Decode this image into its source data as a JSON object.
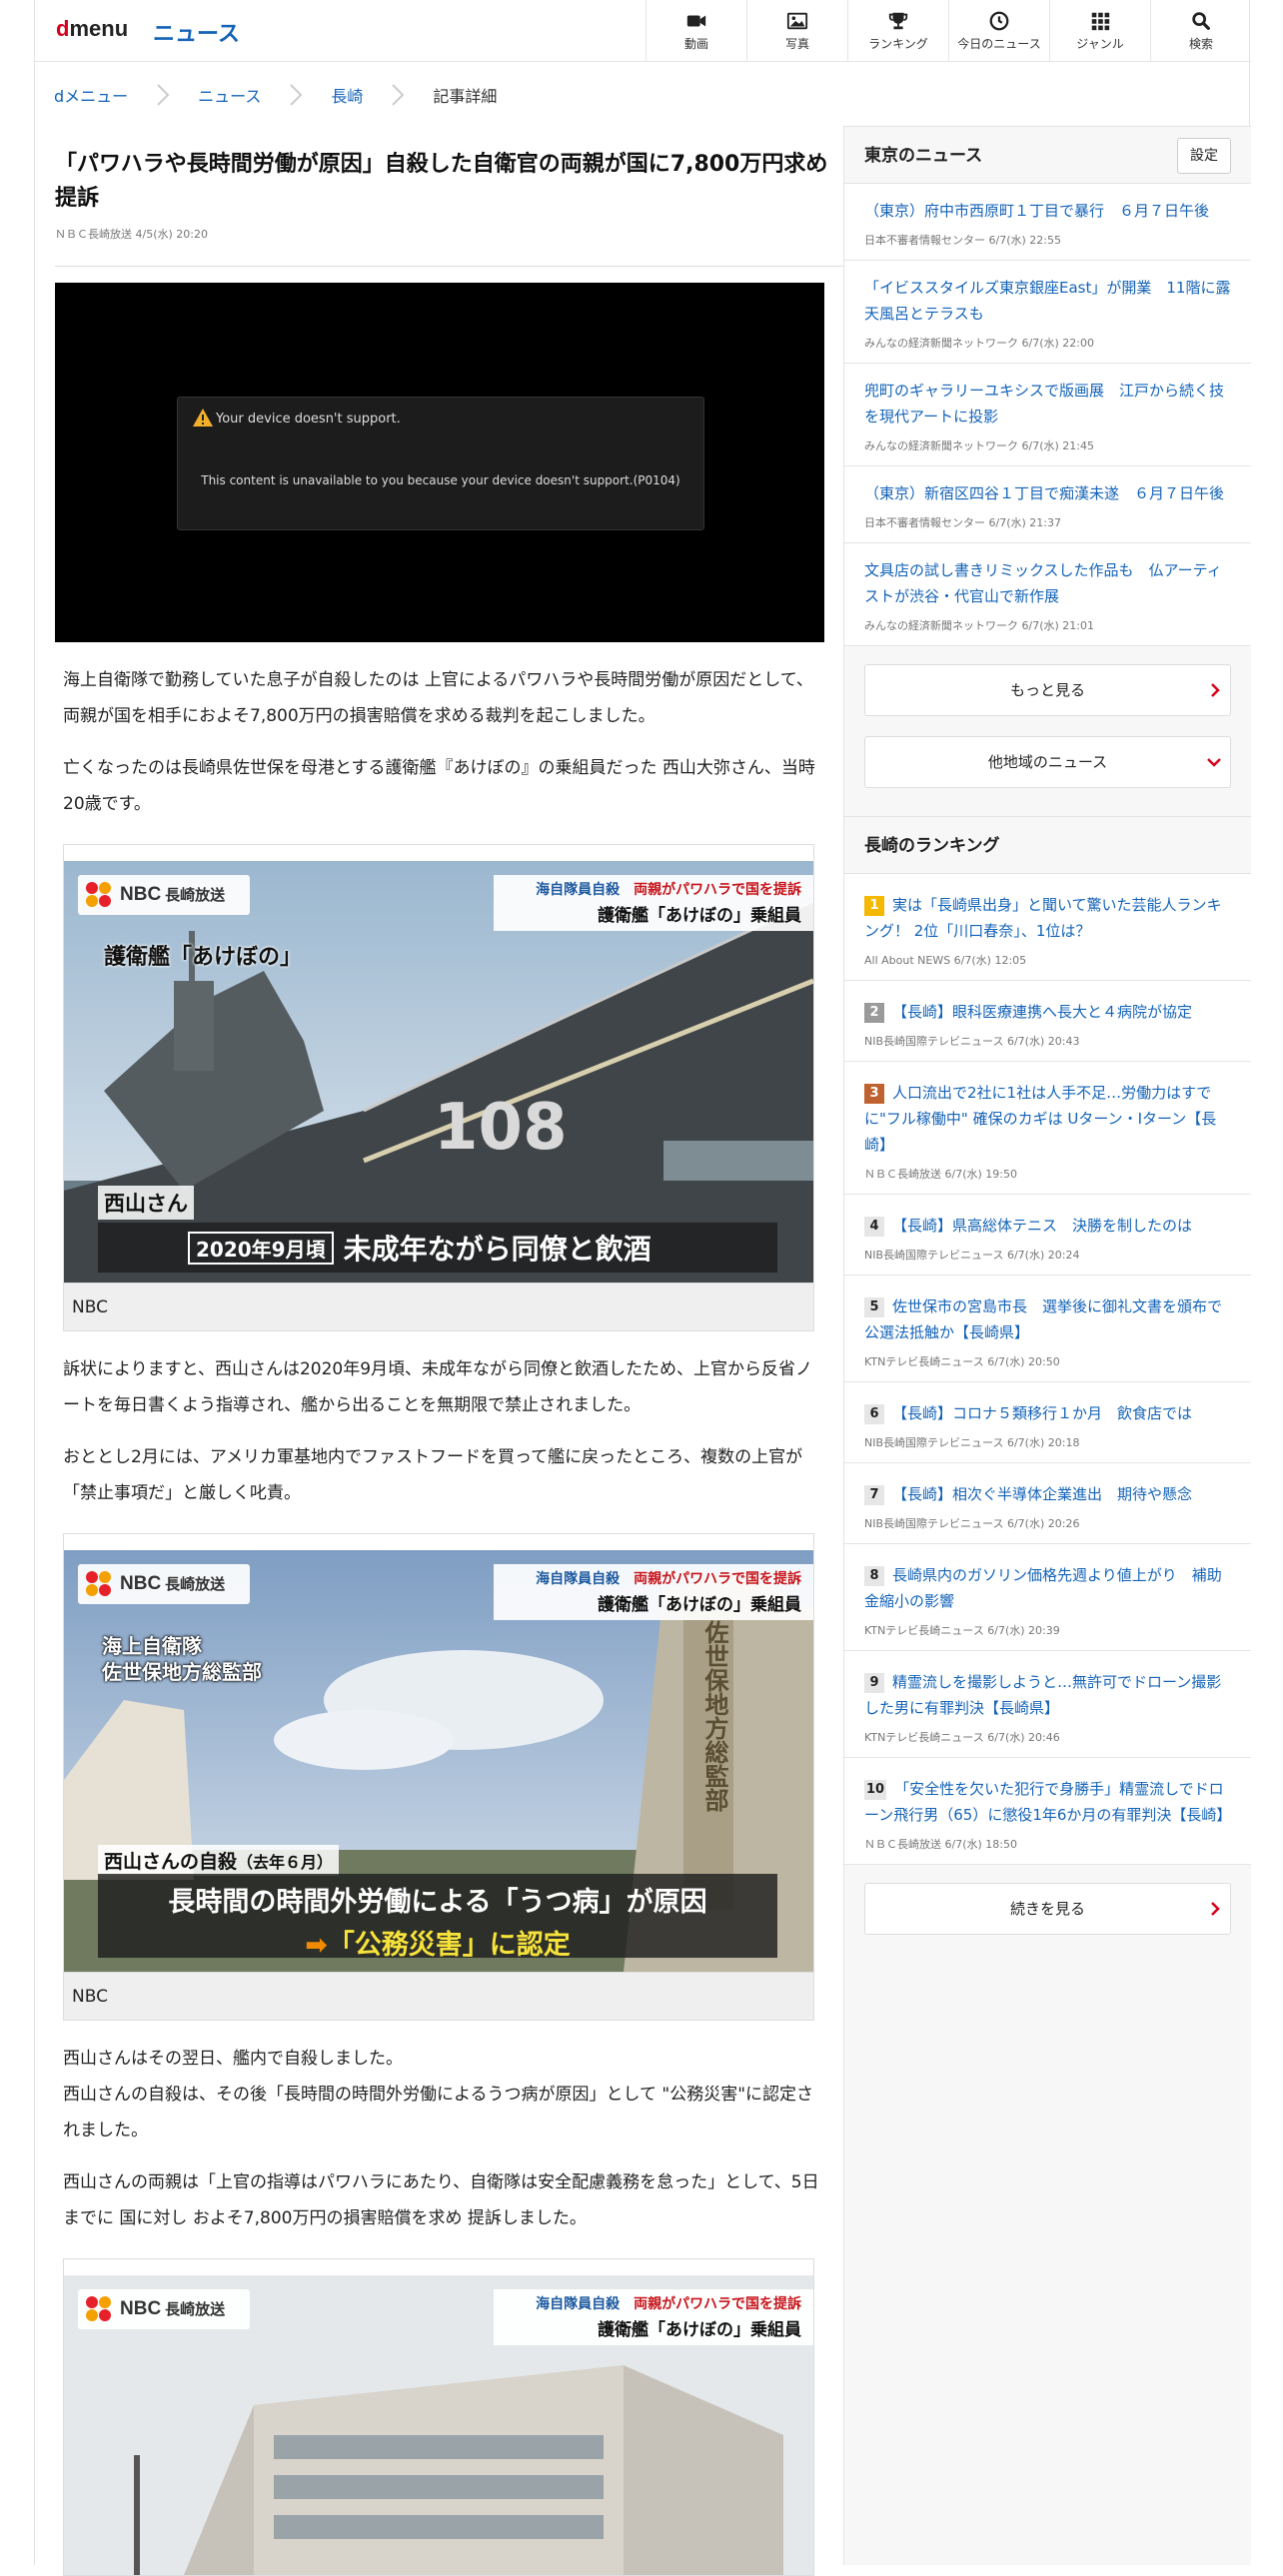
{
  "header": {
    "logo_d": "d",
    "logo_rest": "menu",
    "site_title": "ニュース",
    "nav": [
      {
        "label": "動画",
        "icon": "video-icon"
      },
      {
        "label": "写真",
        "icon": "photo-icon"
      },
      {
        "label": "ランキング",
        "icon": "trophy-icon"
      },
      {
        "label": "今日のニュース",
        "icon": "clock-icon"
      },
      {
        "label": "ジャンル",
        "icon": "grid-icon"
      },
      {
        "label": "検索",
        "icon": "search-icon"
      }
    ]
  },
  "breadcrumb": [
    "dメニュー",
    "ニュース",
    "長崎",
    "記事詳細"
  ],
  "article": {
    "title": "「パワハラや長時間労働が原因」自殺した自衛官の両親が国に7,800万円求め提訴",
    "meta": "ＮＢＣ長崎放送 4/5(水) 20:20",
    "video": {
      "heading": "Your device doesn't support.",
      "body": "This content is unavailable to you because your device doesn't support.(P0104)"
    },
    "paragraphs": [
      "海上自衛隊で勤務していた息子が自殺したのは 上官によるパワハラや長時間労働が原因だとして、両親が国を相手におよそ7,800万円の損害賠償を求める裁判を起こしました。",
      "亡くなったのは長崎県佐世保を母港とする護衛艦『あけぼの』の乗組員だった 西山大弥さん、当時20歳です。",
      "訴状によりますと、西山さんは2020年9月頃、未成年ながら同僚と飲酒したため、上官から反省ノートを毎日書くよう指導され、艦から出ることを無期限で禁止されました。",
      "おととし2月には、アメリカ軍基地内でファストフードを買って艦に戻ったところ、複数の上官が「禁止事項だ」と厳しく叱責。",
      "西山さんはその翌日、艦内で自殺しました。\n西山さんの自殺は、その後「長時間の時間外労働によるうつ病が原因」として \"公務災害\"に認定されました。",
      "西山さんの両親は「上官の指導はパワハラにあたり、自衛隊は安全配慮義務を怠った」として、5日までに 国に対し およそ7,800万円の損害賠償を求め 提訴しました。"
    ],
    "figures": [
      {
        "caption": "NBC",
        "nbc": "NBC",
        "nbc_sub": "長崎放送",
        "tele_1a": "海自隊員自殺",
        "tele_1b": "両親がパワハラで国を提訴",
        "tele_2": "護衛艦「あけぼの」乗組員",
        "label_top": "護衛艦「あけぼの」",
        "ship_number": "108",
        "name": "西山さん",
        "date_tag": "2020年9月頃",
        "lower": "未成年ながら同僚と飲酒"
      },
      {
        "caption": "NBC",
        "nbc": "NBC",
        "nbc_sub": "長崎放送",
        "tele_1a": "海自隊員自殺",
        "tele_1b": "両親がパワハラで国を提訴",
        "tele_2": "護衛艦「あけぼの」乗組員",
        "label_top_1": "海上自衛隊",
        "label_top_2": "佐世保地方総監部",
        "gate_sign": "佐世保地方総監部",
        "name": "西山さんの自殺",
        "date_tag": "（去年６月）",
        "lower_1": "長時間の時間外労働による「うつ病」が原因",
        "lower_2": "「公務災害」に認定"
      },
      {
        "nbc": "NBC",
        "nbc_sub": "長崎放送",
        "tele_1a": "海自隊員自殺",
        "tele_1b": "両親がパワハラで国を提訴",
        "tele_2": "護衛艦「あけぼの」乗組員"
      }
    ]
  },
  "sidebar": {
    "tokyo": {
      "heading": "東京のニュース",
      "setting": "設定",
      "items": [
        {
          "title": "（東京）府中市西原町１丁目で暴行　６月７日午後",
          "source": "日本不審者情報センター 6/7(水) 22:55"
        },
        {
          "title": "「イビススタイルズ東京銀座East」が開業　11階に露天風呂とテラスも",
          "source": "みんなの経済新聞ネットワーク 6/7(水) 22:00"
        },
        {
          "title": "兜町のギャラリーユキシスで版画展　江戸から続く技を現代アートに投影",
          "source": "みんなの経済新聞ネットワーク 6/7(水) 21:45"
        },
        {
          "title": "（東京）新宿区四谷１丁目で痴漢未遂　６月７日午後",
          "source": "日本不審者情報センター 6/7(水) 21:37"
        },
        {
          "title": "文具店の試し書きリミックスした作品も　仏アーティストが渋谷・代官山で新作展",
          "source": "みんなの経済新聞ネットワーク 6/7(水) 21:01"
        }
      ],
      "more": "もっと見る",
      "other": "他地域のニュース"
    },
    "ranking": {
      "heading": "長崎のランキング",
      "items": [
        {
          "num": "1",
          "title": "実は「長崎県出身」と聞いて驚いた芸能人ランキング！ 2位「川口春奈」、1位は？",
          "source": "All About NEWS 6/7(水) 12:05"
        },
        {
          "num": "2",
          "title": "【長崎】眼科医療連携へ長大と４病院が協定",
          "source": "NIB長崎国際テレビニュース 6/7(水) 20:43"
        },
        {
          "num": "3",
          "title": "人口流出で2社に1社は人手不足…労働力はすでに\"フル稼働中\" 確保のカギは Uターン・Iターン【長崎】",
          "source": "ＮＢＣ長崎放送 6/7(水) 19:50"
        },
        {
          "num": "4",
          "title": "【長崎】県高総体テニス　決勝を制したのは",
          "source": "NIB長崎国際テレビニュース 6/7(水) 20:24"
        },
        {
          "num": "5",
          "title": "佐世保市の宮島市長　選挙後に御礼文書を頒布で公選法抵触か【長崎県】",
          "source": "KTNテレビ長崎ニュース 6/7(水) 20:50"
        },
        {
          "num": "6",
          "title": "【長崎】コロナ５類移行１か月　飲食店では",
          "source": "NIB長崎国際テレビニュース 6/7(水) 20:18"
        },
        {
          "num": "7",
          "title": "【長崎】相次ぐ半導体企業進出　期待や懸念",
          "source": "NIB長崎国際テレビニュース 6/7(水) 20:26"
        },
        {
          "num": "8",
          "title": "長崎県内のガソリン価格先週より値上がり　補助金縮小の影響",
          "source": "KTNテレビ長崎ニュース 6/7(水) 20:39"
        },
        {
          "num": "9",
          "title": "精霊流しを撮影しようと…無許可でドローン撮影した男に有罪判決【長崎県】",
          "source": "KTNテレビ長崎ニュース 6/7(水) 20:46"
        },
        {
          "num": "10",
          "title": "「安全性を欠いた犯行で身勝手」精霊流しでドローン飛行男（65）に懲役1年6か月の有罪判決【長崎】",
          "source": "ＮＢＣ長崎放送 6/7(水) 18:50"
        }
      ],
      "more": "続きを見る"
    }
  }
}
